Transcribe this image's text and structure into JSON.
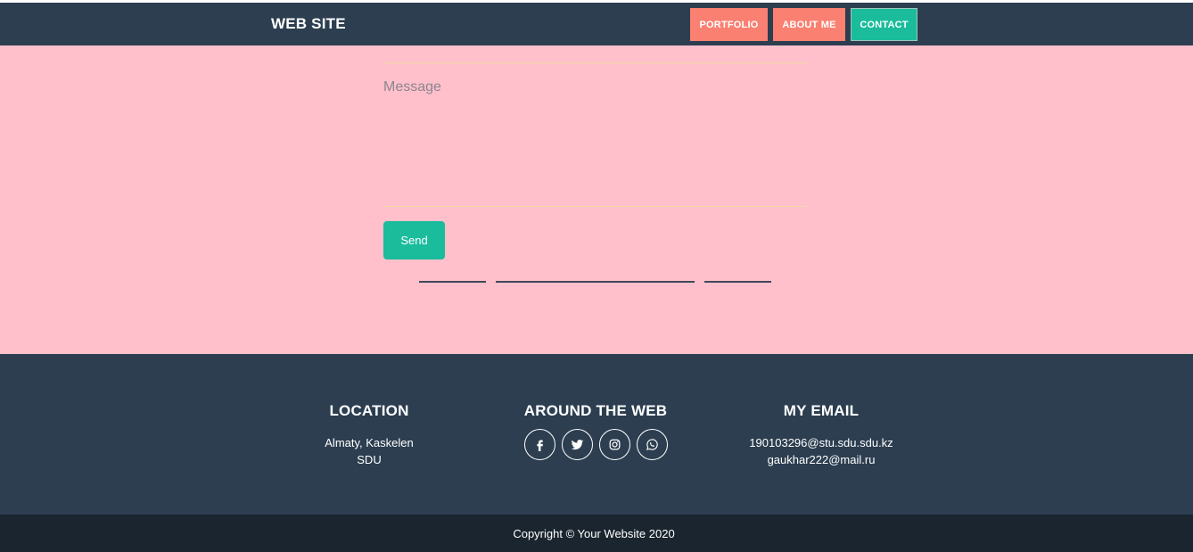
{
  "nav": {
    "brand": "WEB SITE",
    "items": [
      {
        "label": "PORTFOLIO"
      },
      {
        "label": "ABOUT ME"
      },
      {
        "label": "CONTACT"
      }
    ]
  },
  "contact": {
    "message_placeholder": "Message",
    "send_label": "Send"
  },
  "footer": {
    "location": {
      "heading": "LOCATION",
      "line1": "Almaty, Kaskelen",
      "line2": "SDU"
    },
    "web": {
      "heading": "AROUND THE WEB",
      "icons": [
        "facebook-icon",
        "twitter-icon",
        "instagram-icon",
        "whatsapp-icon"
      ]
    },
    "email": {
      "heading": "MY EMAIL",
      "line1": "190103296@stu.sdu.sdu.kz",
      "line2": "gaukhar222@mail.ru"
    }
  },
  "copyright": "Copyright © Your Website 2020",
  "colors": {
    "navbar": "#2c3e50",
    "accent_salmon": "#fa8072",
    "accent_teal": "#1abc9c",
    "section_pink": "#ffc0cb",
    "copyright_bg": "#1a252f"
  }
}
